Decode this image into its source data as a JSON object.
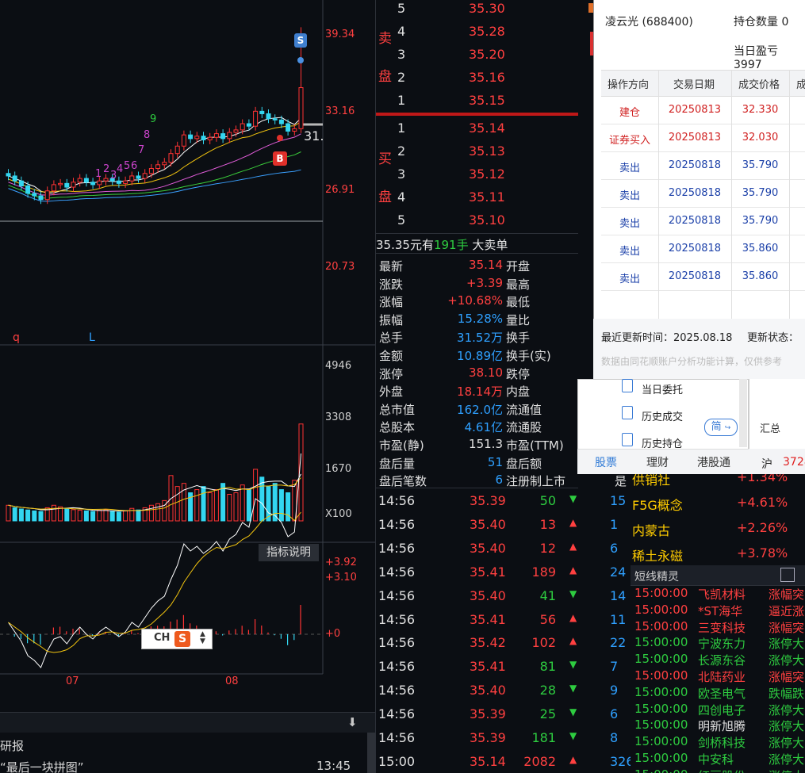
{
  "chart": {
    "price_labels": [
      "39.34",
      "33.16",
      "26.91",
      "20.73"
    ],
    "last_price_tag": "31.",
    "signal_sell": "S",
    "signal_buy": "B",
    "seq_top": [
      "7",
      "8",
      "9"
    ],
    "seq_low": [
      "1",
      "2",
      "3",
      "4",
      "5",
      "6"
    ],
    "marker_q": "q",
    "marker_l": "L",
    "volume_labels": [
      "4946",
      "3308",
      "1670"
    ],
    "volume_unit": "X100",
    "indicator_button": "指标说明",
    "macd_labels": [
      "+3.92",
      "+3.10",
      "+0"
    ],
    "month_labels": [
      "07",
      "08"
    ],
    "colors": {
      "up": "#ff3333",
      "down": "#33d6f0",
      "ma_white": "#ffffff",
      "ma_yellow": "#f2c40f",
      "ma_pink": "#e05cd8",
      "ma_green": "#3bcf3b",
      "ma_blue": "#3aa0ff"
    }
  },
  "ime": {
    "label": "CH",
    "logo": "S"
  },
  "news": {
    "header_icon": "download-icon",
    "item1": "研报",
    "item2": "“最后一块拼图”",
    "item2_time": "13:45"
  },
  "orderbook": {
    "sell_label_1": "卖",
    "sell_label_2": "盘",
    "buy_label_1": "买",
    "buy_label_2": "盘",
    "asks": [
      {
        "level": "5",
        "price": "35.30"
      },
      {
        "level": "4",
        "price": "35.28"
      },
      {
        "level": "3",
        "price": "35.20"
      },
      {
        "level": "2",
        "price": "35.16"
      },
      {
        "level": "1",
        "price": "35.15"
      }
    ],
    "bids": [
      {
        "level": "1",
        "price": "35.14"
      },
      {
        "level": "2",
        "price": "35.13"
      },
      {
        "level": "3",
        "price": "35.12"
      },
      {
        "level": "4",
        "price": "35.11"
      },
      {
        "level": "5",
        "price": "35.10"
      }
    ],
    "big_order": {
      "prefix": "35.35元有",
      "amount": "191手",
      "suffix": "大卖单"
    }
  },
  "quote": [
    {
      "k1": "最新",
      "v1": "35.14",
      "c1": "red",
      "k2": "开盘"
    },
    {
      "k1": "涨跌",
      "v1": "+3.39",
      "c1": "red",
      "k2": "最高"
    },
    {
      "k1": "涨幅",
      "v1": "+10.68%",
      "c1": "red",
      "k2": "最低"
    },
    {
      "k1": "振幅",
      "v1": "15.28%",
      "c1": "blue",
      "k2": "量比"
    },
    {
      "k1": "总手",
      "v1": "31.52万",
      "c1": "blue",
      "k2": "换手"
    },
    {
      "k1": "金额",
      "v1": "10.89亿",
      "c1": "blue",
      "k2": "换手(实)"
    },
    {
      "k1": "涨停",
      "v1": "38.10",
      "c1": "red",
      "k2": "跌停"
    },
    {
      "k1": "外盘",
      "v1": "18.14万",
      "c1": "red",
      "k2": "内盘"
    },
    {
      "k1": "总市值",
      "v1": "162.0亿",
      "c1": "blue",
      "k2": "流通值"
    },
    {
      "k1": "总股本",
      "v1": "4.61亿",
      "c1": "blue",
      "k2": "流通股"
    },
    {
      "k1": "市盈(静)",
      "v1": "151.3",
      "c1": "white",
      "k2": "市盈(TTM)"
    },
    {
      "k1": "盘后量",
      "v1": "51",
      "c1": "blue",
      "k2": "盘后额"
    },
    {
      "k1": "盘后笔数",
      "v1": "6",
      "c1": "blue",
      "k2": "注册制上市"
    }
  ],
  "quote_extra": "是",
  "trades": [
    {
      "time": "14:56",
      "price": "35.39",
      "vol": "50",
      "dir": "down",
      "n": "15"
    },
    {
      "time": "14:56",
      "price": "35.40",
      "vol": "13",
      "dir": "up",
      "n": "1"
    },
    {
      "time": "14:56",
      "price": "35.40",
      "vol": "12",
      "dir": "up",
      "n": "6"
    },
    {
      "time": "14:56",
      "price": "35.41",
      "vol": "189",
      "dir": "up",
      "n": "24"
    },
    {
      "time": "14:56",
      "price": "35.40",
      "vol": "41",
      "dir": "down",
      "n": "14"
    },
    {
      "time": "14:56",
      "price": "35.41",
      "vol": "56",
      "dir": "up",
      "n": "11"
    },
    {
      "time": "14:56",
      "price": "35.42",
      "vol": "102",
      "dir": "up",
      "n": "22"
    },
    {
      "time": "14:56",
      "price": "35.41",
      "vol": "81",
      "dir": "down",
      "n": "7"
    },
    {
      "time": "14:56",
      "price": "35.40",
      "vol": "28",
      "dir": "down",
      "n": "9"
    },
    {
      "time": "14:56",
      "price": "35.39",
      "vol": "25",
      "dir": "down",
      "n": "6"
    },
    {
      "time": "14:56",
      "price": "35.39",
      "vol": "181",
      "dir": "down",
      "n": "8"
    },
    {
      "time": "15:00",
      "price": "35.14",
      "vol": "2082",
      "dir": "up",
      "n": "326"
    }
  ],
  "sectors": [
    {
      "name": "供销社",
      "chg": "+1.34%"
    },
    {
      "name": "F5G概念",
      "chg": "+4.61%"
    },
    {
      "name": "内蒙古",
      "chg": "+2.26%"
    },
    {
      "name": "稀土永磁",
      "chg": "+3.78%"
    }
  ],
  "elf": {
    "title": "短线精灵",
    "rows": [
      {
        "time": "15:00:00",
        "stock": "飞凯材料",
        "event": "涨幅突",
        "color": "red"
      },
      {
        "time": "15:00:00",
        "stock": "*ST海华",
        "event": "逼近涨",
        "color": "red"
      },
      {
        "time": "15:00:00",
        "stock": "三变科技",
        "event": "涨幅突",
        "color": "red"
      },
      {
        "time": "15:00:00",
        "stock": "宁波东力",
        "event": "涨停大",
        "color": "green"
      },
      {
        "time": "15:00:00",
        "stock": "长源东谷",
        "event": "涨停大",
        "color": "green"
      },
      {
        "time": "15:00:00",
        "stock": "北陆药业",
        "event": "涨幅突",
        "color": "red"
      },
      {
        "time": "15:00:00",
        "stock": "欧圣电气",
        "event": "跌幅跌",
        "color": "green"
      },
      {
        "time": "15:00:00",
        "stock": "四创电子",
        "event": "涨停大",
        "color": "green"
      },
      {
        "time": "15:00:00",
        "stock": "明新旭腾",
        "event": "涨停大",
        "color": "green"
      },
      {
        "time": "15:00:00",
        "stock": "剑桥科技",
        "event": "涨停大",
        "color": "green"
      },
      {
        "time": "15:00:00",
        "stock": "中安科",
        "event": "涨停大",
        "color": "green"
      },
      {
        "time": "15:00:00",
        "stock": "红豆股份",
        "event": "涨停大",
        "color": "green"
      }
    ]
  },
  "dialog": {
    "stock": "凌云光 (688400)",
    "position_label": "持仓数量 0",
    "pnl_label": "当日盈亏 3997",
    "headers": [
      "操作方向",
      "交易日期",
      "成交价格",
      "成"
    ],
    "rows": [
      {
        "dir": "建仓",
        "date": "20250813",
        "price": "32.330",
        "color": "red"
      },
      {
        "dir": "证券买入",
        "date": "20250813",
        "price": "32.030",
        "color": "red"
      },
      {
        "dir": "卖出",
        "date": "20250818",
        "price": "35.790",
        "color": "blue"
      },
      {
        "dir": "卖出",
        "date": "20250818",
        "price": "35.790",
        "color": "blue"
      },
      {
        "dir": "卖出",
        "date": "20250818",
        "price": "35.790",
        "color": "blue"
      },
      {
        "dir": "卖出",
        "date": "20250818",
        "price": "35.860",
        "color": "blue"
      },
      {
        "dir": "卖出",
        "date": "20250818",
        "price": "35.860",
        "color": "blue"
      }
    ],
    "update_time": "最近更新时间：2025.08.18",
    "update_status": "更新状态：",
    "note": "数据由同花顺账户分析功能计算，仅供参考"
  },
  "side_panel": {
    "items": [
      "当日委托",
      "历史成交",
      "历史持仓"
    ],
    "simp_button": "简",
    "tabs": [
      "股票",
      "理财",
      "港股通"
    ],
    "mini_total": "汇总",
    "mini_hu": "沪",
    "mini_hu_val": "3728"
  }
}
